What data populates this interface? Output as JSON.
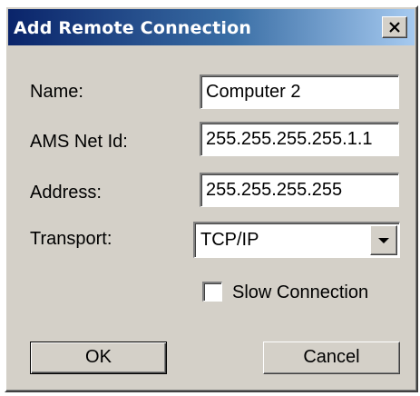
{
  "dialog": {
    "title": "Add Remote Connection",
    "close_icon": "close-icon"
  },
  "fields": {
    "name": {
      "label": "Name:",
      "value": "Computer 2"
    },
    "ams_net_id": {
      "label": "AMS Net Id:",
      "value": "255.255.255.255.1.1"
    },
    "address": {
      "label": "Address:",
      "value": "255.255.255.255"
    },
    "transport": {
      "label": "Transport:",
      "selected": "TCP/IP",
      "arrow_icon": "chevron-down-icon"
    }
  },
  "options": {
    "slow_connection": {
      "label": "Slow Connection",
      "checked": false
    }
  },
  "buttons": {
    "ok": "OK",
    "cancel": "Cancel"
  },
  "colors": {
    "face": "#d4d0c8",
    "title_start": "#0a246a",
    "title_end": "#a6caf0"
  }
}
